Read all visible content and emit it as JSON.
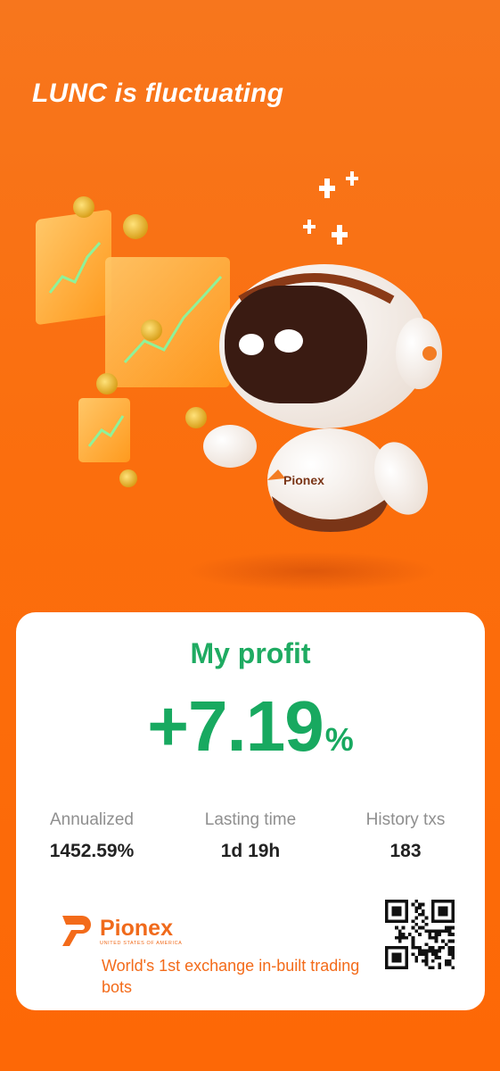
{
  "headline": "LUNC is fluctuating",
  "illustration": {
    "mascot_badge": "Pionex"
  },
  "card": {
    "profit_label": "My profit",
    "profit_value": "+7.19",
    "profit_unit": "%",
    "stats": [
      {
        "label": "Annualized",
        "value": "1452.59%"
      },
      {
        "label": "Lasting time",
        "value": "1d 19h"
      },
      {
        "label": "History txs",
        "value": "183"
      }
    ],
    "brand": {
      "name": "Pionex",
      "subtitle": "UNITED STATES OF AMERICA"
    },
    "tagline": "World's 1st exchange in-built trading bots"
  },
  "colors": {
    "background": "#fb6e0d",
    "profit_green": "#18a960",
    "brand_orange": "#f06a1b"
  }
}
